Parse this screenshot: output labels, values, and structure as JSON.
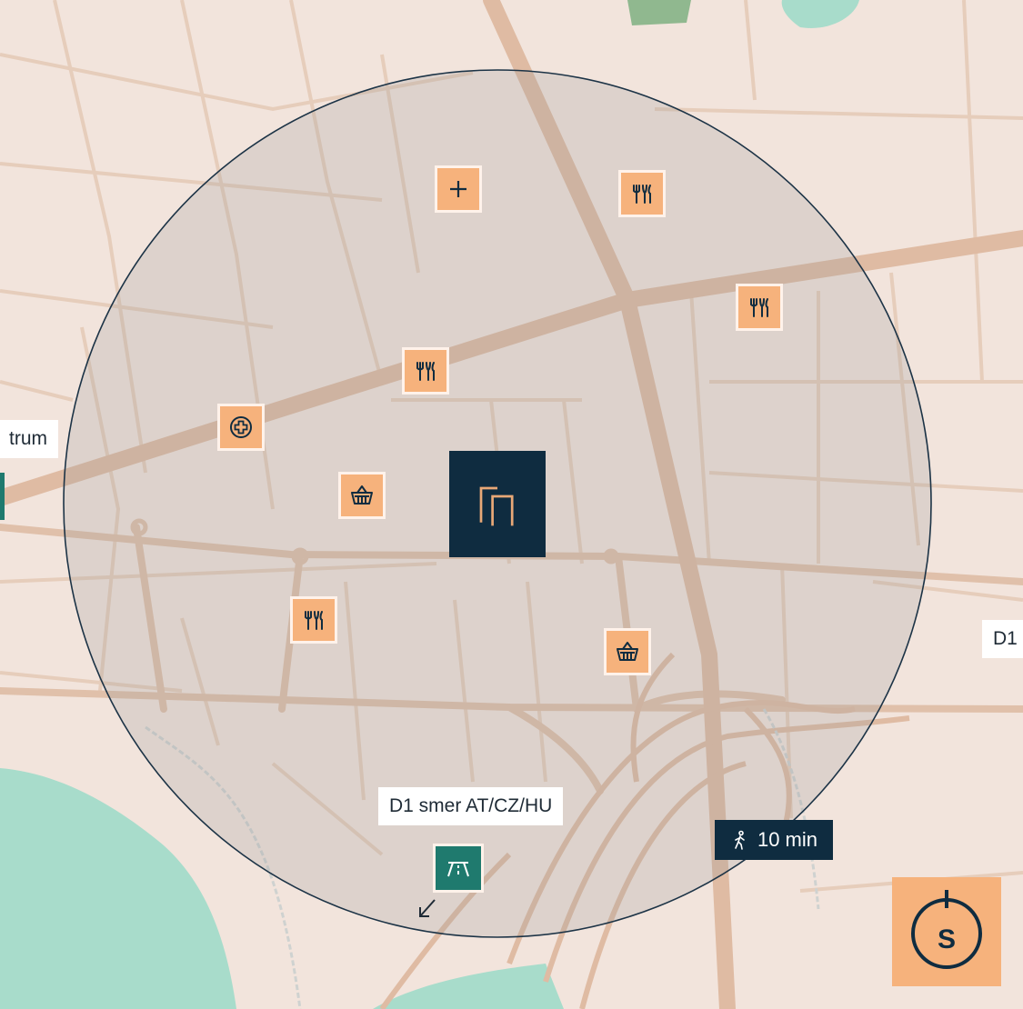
{
  "map": {
    "labels": {
      "centrum": "trum",
      "d1_right": "D1",
      "highway_direction": "D1 smer AT/CZ/HU"
    },
    "walk_badge": {
      "text": "10 min",
      "icon": "walking-person-icon"
    },
    "compass_letter": "S",
    "pois": [
      {
        "type": "pharmacy",
        "icon": "plus-icon"
      },
      {
        "type": "restaurant",
        "icon": "cutlery-icon"
      },
      {
        "type": "restaurant",
        "icon": "cutlery-icon"
      },
      {
        "type": "restaurant",
        "icon": "cutlery-icon"
      },
      {
        "type": "hospital",
        "icon": "medical-cross-icon"
      },
      {
        "type": "shop",
        "icon": "shopping-basket-icon"
      },
      {
        "type": "restaurant",
        "icon": "cutlery-icon"
      },
      {
        "type": "shop",
        "icon": "shopping-basket-icon"
      }
    ],
    "colors": {
      "background": "#f2e4dc",
      "road": "#e3c6b1",
      "major_road": "#dfbba3",
      "water": "#a8dccb",
      "park": "#7fb081",
      "radius_fill": "#9a9a9a",
      "radius_stroke": "#1c3346",
      "poi": "#f6b27c",
      "navy": "#0f2c40",
      "teal": "#1f7a6e"
    }
  }
}
